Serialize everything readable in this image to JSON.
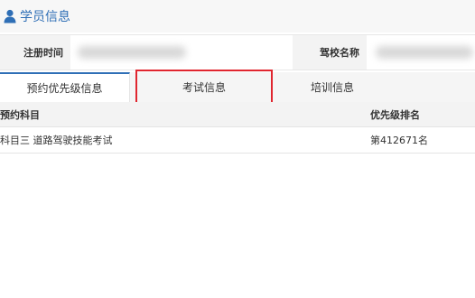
{
  "section": {
    "title": "学员信息",
    "icon": "user-icon",
    "title_color": "#2f6fb6"
  },
  "info": {
    "registration_time_label": "注册时间",
    "driving_school_label": "驾校名称"
  },
  "tabs": [
    {
      "label": "预约优先级信息",
      "active": true
    },
    {
      "label": "考试信息",
      "active": false,
      "highlighted": true
    },
    {
      "label": "培训信息",
      "active": false
    }
  ],
  "table": {
    "headers": {
      "subject": "预约科目",
      "rank": "优先级排名"
    },
    "rows": [
      {
        "subject": "科目三 道路驾驶技能考试",
        "rank": "第412671名"
      }
    ]
  },
  "colors": {
    "accent": "#2f6fb6",
    "highlight_border": "#e0262f"
  }
}
